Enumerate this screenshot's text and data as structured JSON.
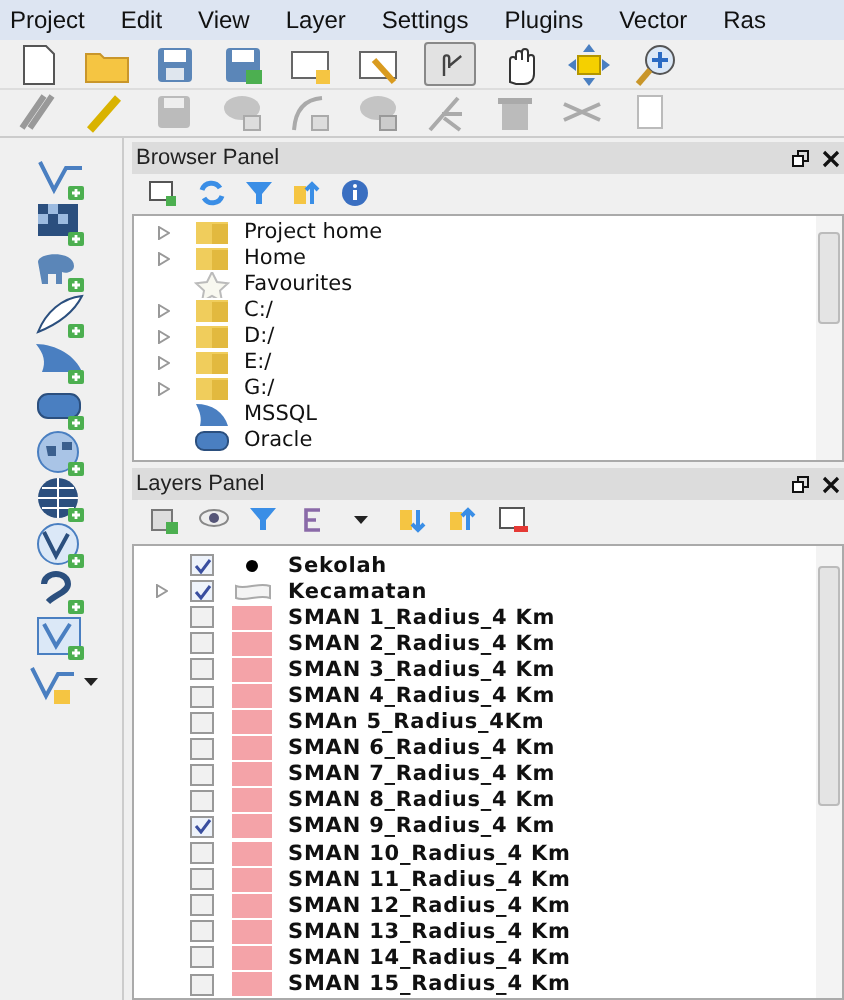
{
  "menu": [
    "Project",
    "Edit",
    "View",
    "Layer",
    "Settings",
    "Plugins",
    "Vector",
    "Ras"
  ],
  "browser_panel": {
    "title": "Browser Panel",
    "items": [
      {
        "label": "Project home",
        "kind": "folder",
        "expandable": true
      },
      {
        "label": "Home",
        "kind": "folder",
        "expandable": true
      },
      {
        "label": "Favourites",
        "kind": "star",
        "expandable": false
      },
      {
        "label": "C:/",
        "kind": "folder",
        "expandable": true
      },
      {
        "label": "D:/",
        "kind": "folder",
        "expandable": true
      },
      {
        "label": "E:/",
        "kind": "folder",
        "expandable": true
      },
      {
        "label": "G:/",
        "kind": "folder",
        "expandable": true
      },
      {
        "label": "MSSQL",
        "kind": "fin",
        "expandable": false
      },
      {
        "label": "Oracle",
        "kind": "capsule",
        "expandable": false
      }
    ]
  },
  "layers_panel": {
    "title": "Layers Panel",
    "layers": [
      {
        "label": "Sekolah",
        "kind": "point",
        "checked": true,
        "expandable": false
      },
      {
        "label": "Kecamatan",
        "kind": "polygon",
        "checked": true,
        "expandable": true
      },
      {
        "label": "SMAN 1_Radius_4 Km",
        "kind": "fill",
        "checked": false,
        "expandable": false,
        "color": "#f4a3a8"
      },
      {
        "label": "SMAN 2_Radius_4 Km",
        "kind": "fill",
        "checked": false,
        "expandable": false,
        "color": "#f4a3a8"
      },
      {
        "label": "SMAN 3_Radius_4 Km",
        "kind": "fill",
        "checked": false,
        "expandable": false,
        "color": "#f4a3a8"
      },
      {
        "label": "SMAN 4_Radius_4 Km",
        "kind": "fill",
        "checked": false,
        "expandable": false,
        "color": "#f4a3a8"
      },
      {
        "label": "SMAn 5_Radius_4Km",
        "kind": "fill",
        "checked": false,
        "expandable": false,
        "color": "#f4a3a8"
      },
      {
        "label": "SMAN 6_Radius_4 Km",
        "kind": "fill",
        "checked": false,
        "expandable": false,
        "color": "#f4a3a8"
      },
      {
        "label": "SMAN 7_Radius_4 Km",
        "kind": "fill",
        "checked": false,
        "expandable": false,
        "color": "#f4a3a8"
      },
      {
        "label": "SMAN 8_Radius_4 Km",
        "kind": "fill",
        "checked": false,
        "expandable": false,
        "color": "#f4a3a8"
      },
      {
        "label": "SMAN 9_Radius_4 Km",
        "kind": "fill",
        "checked": true,
        "expandable": false,
        "color": "#f4a3a8"
      },
      {
        "label": "SMAN 10_Radius_4 Km",
        "kind": "fill",
        "checked": false,
        "expandable": false,
        "color": "#f4a3a8"
      },
      {
        "label": "SMAN 11_Radius_4 Km",
        "kind": "fill",
        "checked": false,
        "expandable": false,
        "color": "#f4a3a8"
      },
      {
        "label": "SMAN 12_Radius_4 Km",
        "kind": "fill",
        "checked": false,
        "expandable": false,
        "color": "#f4a3a8"
      },
      {
        "label": "SMAN 13_Radius_4 Km",
        "kind": "fill",
        "checked": false,
        "expandable": false,
        "color": "#f4a3a8"
      },
      {
        "label": "SMAN 14_Radius_4 Km",
        "kind": "fill",
        "checked": false,
        "expandable": false,
        "color": "#f4a3a8"
      },
      {
        "label": "SMAN 15_Radius_4 Km",
        "kind": "fill",
        "checked": false,
        "expandable": false,
        "color": "#f4a3a8"
      }
    ]
  }
}
